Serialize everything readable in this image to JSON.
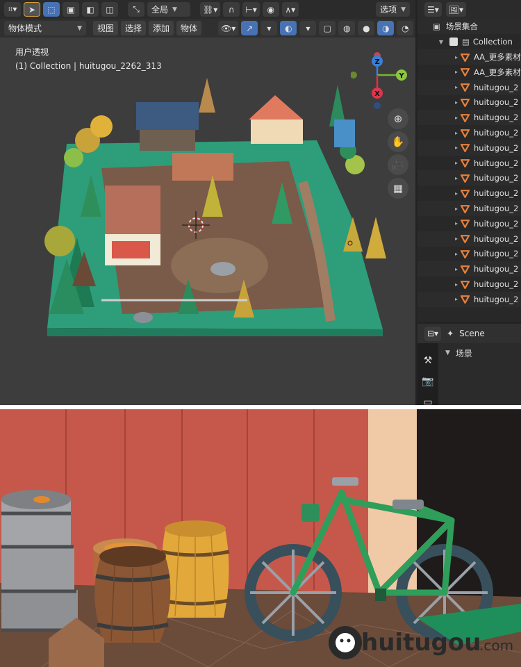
{
  "toolbar1": {
    "transform_orientation": "全局",
    "options_label": "选项"
  },
  "toolbar2": {
    "mode": "物体模式",
    "menus": [
      "视图",
      "选择",
      "添加",
      "物体"
    ]
  },
  "viewport": {
    "view_name": "用户透视",
    "collection_info": "(1) Collection | huitugou_2262_313",
    "gizmo": {
      "z": "Z",
      "y": "Y",
      "x": "X"
    }
  },
  "outliner": {
    "root": "场景集合",
    "collection": "Collection",
    "items": [
      "AA_更多素材",
      "AA_更多素材",
      "huitugou_2",
      "huitugou_2",
      "huitugou_2",
      "huitugou_2",
      "huitugou_2",
      "huitugou_2",
      "huitugou_2",
      "huitugou_2",
      "huitugou_2",
      "huitugou_2",
      "huitugou_2",
      "huitugou_2",
      "huitugou_2",
      "huitugou_2",
      "huitugou_2"
    ]
  },
  "properties": {
    "scene_name": "Scene",
    "section": "场景"
  },
  "watermark": {
    "brand": "huitugou",
    "suffix": ".com"
  },
  "colors": {
    "object_icon": "#e8803a",
    "active_blue": "#4772b3",
    "bike_green": "#2f9e5a",
    "barn_red": "#c9564a"
  }
}
